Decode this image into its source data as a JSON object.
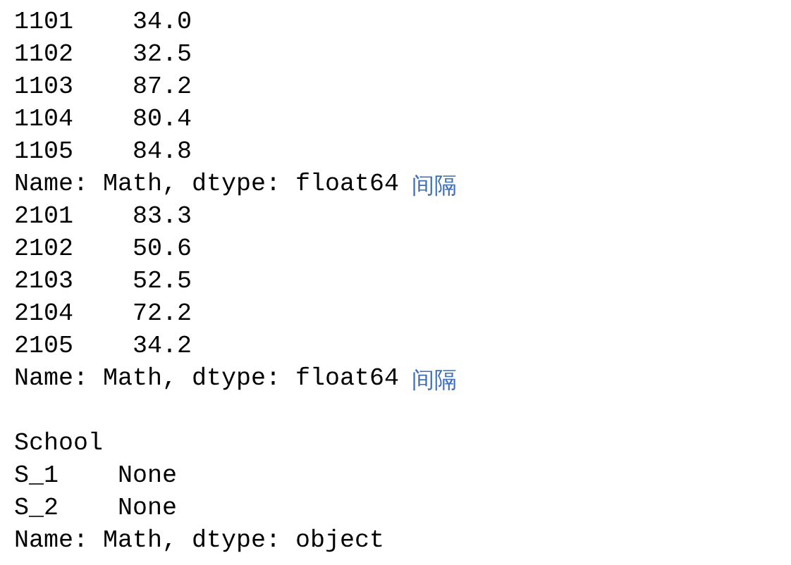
{
  "console_output": {
    "blocks": [
      [
        {
          "text": "1101    34.0"
        },
        {
          "text": "1102    32.5"
        },
        {
          "text": "1103    87.2"
        },
        {
          "text": "1104    80.4"
        },
        {
          "text": "1105    84.8"
        },
        {
          "text": "Name: Math, dtype: float64",
          "note": "间隔"
        },
        {
          "text": "2101    83.3"
        },
        {
          "text": "2102    50.6"
        },
        {
          "text": "2103    52.5"
        },
        {
          "text": "2104    72.2"
        },
        {
          "text": "2105    34.2"
        },
        {
          "text": "Name: Math, dtype: float64",
          "note": "间隔"
        }
      ],
      [
        {
          "text": "School"
        },
        {
          "text": "S_1    None"
        },
        {
          "text": "S_2    None"
        },
        {
          "text": "Name: Math, dtype: object"
        }
      ]
    ]
  }
}
